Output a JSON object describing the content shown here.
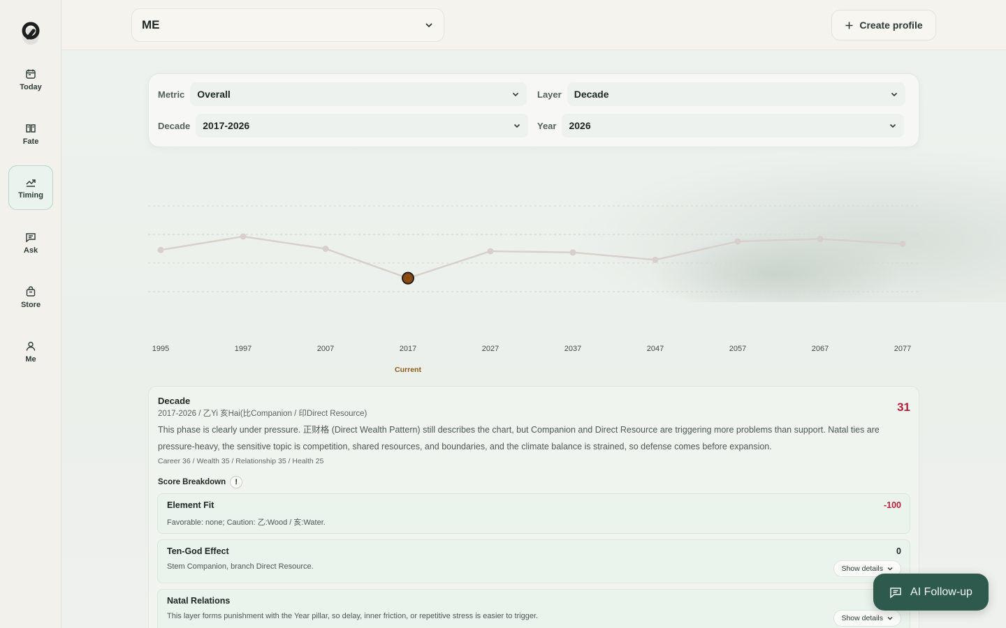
{
  "nav": {
    "items": [
      {
        "label": "Today",
        "icon": "calendar-icon"
      },
      {
        "label": "Fate",
        "icon": "book-icon"
      },
      {
        "label": "Timing",
        "icon": "trend-icon",
        "active": true
      },
      {
        "label": "Ask",
        "icon": "message-icon"
      },
      {
        "label": "Store",
        "icon": "bag-icon"
      },
      {
        "label": "Me",
        "icon": "user-icon"
      }
    ]
  },
  "header": {
    "profile_value": "ME",
    "create_label": "Create profile"
  },
  "filters": {
    "metric_label": "Metric",
    "metric_value": "Overall",
    "layer_label": "Layer",
    "layer_value": "Decade",
    "decade_label": "Decade",
    "decade_value": "2017-2026",
    "year_label": "Year",
    "year_value": "2026"
  },
  "chart_data": {
    "type": "line",
    "x": [
      "1995",
      "1997",
      "2007",
      "2017",
      "2027",
      "2037",
      "2047",
      "2057",
      "2067",
      "2077"
    ],
    "values": [
      54,
      65,
      55,
      31,
      53,
      52,
      46,
      61,
      63,
      59
    ],
    "highlight_index": 3,
    "highlight_label": "Current",
    "ylim": [
      0,
      100
    ],
    "grid": true,
    "colors": {
      "line": "#d9d0cc",
      "point": "#d8cfcc",
      "highlight": "#8a4a12",
      "highlight_label": "#8a5a18"
    }
  },
  "decade": {
    "title": "Decade",
    "subtitle": "2017-2026 / 乙Yi 亥Hai(比Companion / 印Direct Resource)",
    "score": "31",
    "description": "This phase is clearly under pressure. 正财格 (Direct Wealth Pattern) still describes the chart, but Companion and Direct Resource are triggering more problems than support. Natal ties are pressure-heavy, the sensitive topic is competition, shared resources, and boundaries, and the climate balance is strained, so defense comes before expansion.",
    "metrics": "Career 36 / Wealth 35 / Relationship 35 / Health 25",
    "breakdown_label": "Score Breakdown",
    "breakdown_badge": "!",
    "items": [
      {
        "name": "Element Fit",
        "desc": "Favorable: none; Caution: 乙:Wood / 亥:Water.",
        "value": "-100",
        "color": "#b3203c"
      },
      {
        "name": "Ten-God Effect",
        "desc": "Stem Companion, branch Direct Resource.",
        "value": "0",
        "color": "#1d2622",
        "details": "Show details"
      },
      {
        "name": "Natal Relations",
        "desc": "This layer forms punishment with the Year pillar, so delay, inner friction, or repetitive stress is easier to trigger.",
        "value": "",
        "color": "#1d2622",
        "details": "Show details"
      }
    ]
  },
  "ai_label": "AI Follow-up"
}
